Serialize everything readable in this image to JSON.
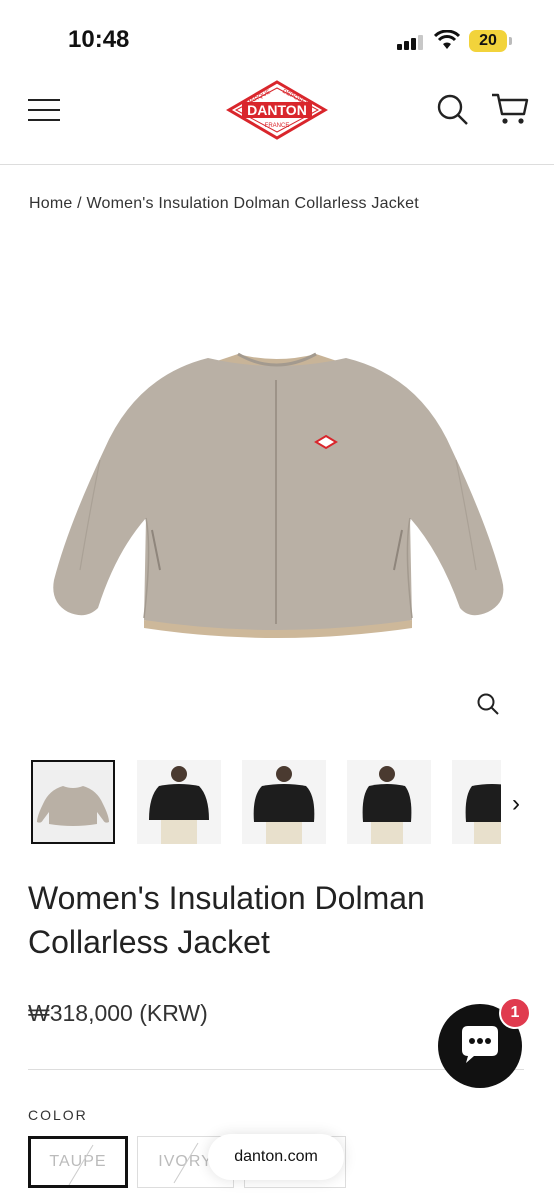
{
  "status_bar": {
    "time": "10:48",
    "battery": "20"
  },
  "header": {
    "logo": {
      "brand": "DANTON",
      "top_left": "MARQUE",
      "top_right": "DEPOSEE",
      "bottom": "FRANCE",
      "color": "#d9262c"
    },
    "icons": [
      "menu-icon",
      "search-icon",
      "cart-icon"
    ]
  },
  "breadcrumb": {
    "home": "Home",
    "separator": "/",
    "current": "Women's Insulation Dolman Collarless Jacket"
  },
  "product": {
    "title": "Women's Insulation Dolman Collarless Jacket",
    "price": "₩318,000 (KRW)",
    "image_color": "#b9b0a5",
    "thumbnails": [
      "jacket-taupe-flat",
      "model-black-front",
      "model-black-front-2",
      "model-black-side",
      "model-black-back"
    ]
  },
  "color_option": {
    "label": "COLOR",
    "options": [
      {
        "name": "TAUPE",
        "selected": true,
        "sold_out": true
      },
      {
        "name": "IVORY",
        "selected": false,
        "sold_out": true
      }
    ]
  },
  "browser": {
    "domain": "danton.com"
  },
  "chat": {
    "badge": "1"
  }
}
